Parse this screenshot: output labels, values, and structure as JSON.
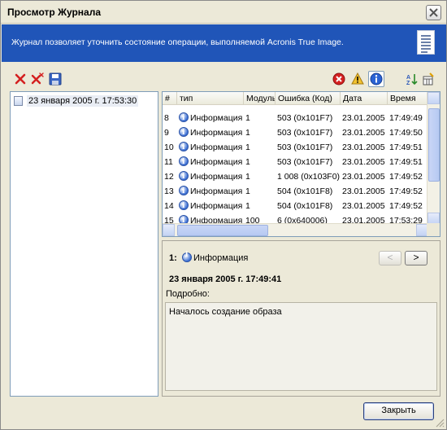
{
  "window": {
    "title": "Просмотр Журнала"
  },
  "banner": {
    "text": "Журнал позволяет уточнить состояние операции, выполняемой Acronis True Image.",
    "icon": "log-document-icon"
  },
  "toolbar_left": [
    {
      "name": "delete-icon",
      "color": "#d42020"
    },
    {
      "name": "delete-all-icon",
      "color": "#d42020"
    },
    {
      "name": "save-icon",
      "color": "#2a57b8"
    }
  ],
  "toolbar_right": [
    {
      "name": "errors-filter-icon",
      "color": "#d42020"
    },
    {
      "name": "warnings-filter-icon",
      "color": "#f2c230"
    },
    {
      "name": "info-filter-icon",
      "color": "#2b63d4"
    },
    {
      "name": "sort-icon"
    },
    {
      "name": "columns-icon"
    }
  ],
  "log_list": [
    {
      "label": "23 января 2005 г. 17:53:30",
      "selected": true
    }
  ],
  "table": {
    "columns": [
      "#",
      "тип",
      "Модуль",
      "Ошибка (Код)",
      "Дата",
      "Время"
    ],
    "rows": [
      [
        "8",
        "Информация",
        "1",
        "503 (0x101F7)",
        "23.01.2005",
        "17:49:49"
      ],
      [
        "9",
        "Информация",
        "1",
        "503 (0x101F7)",
        "23.01.2005",
        "17:49:50"
      ],
      [
        "10",
        "Информация",
        "1",
        "503 (0x101F7)",
        "23.01.2005",
        "17:49:51"
      ],
      [
        "11",
        "Информация",
        "1",
        "503 (0x101F7)",
        "23.01.2005",
        "17:49:51"
      ],
      [
        "12",
        "Информация",
        "1",
        "1 008 (0x103F0)",
        "23.01.2005",
        "17:49:52"
      ],
      [
        "13",
        "Информация",
        "1",
        "504 (0x101F8)",
        "23.01.2005",
        "17:49:52"
      ],
      [
        "14",
        "Информация",
        "1",
        "504 (0x101F8)",
        "23.01.2005",
        "17:49:52"
      ],
      [
        "15",
        "Информация",
        "100",
        "6 (0x640006)",
        "23.01.2005",
        "17:53:29"
      ]
    ]
  },
  "details": {
    "number": "1:",
    "type": "Информация",
    "prev_label": "<",
    "next_label": ">",
    "prev_enabled": false,
    "date": "23 января 2005 г. 17:49:41",
    "label": "Подробно:",
    "text": "Началось создание образа"
  },
  "footer": {
    "close_label": "Закрыть"
  }
}
